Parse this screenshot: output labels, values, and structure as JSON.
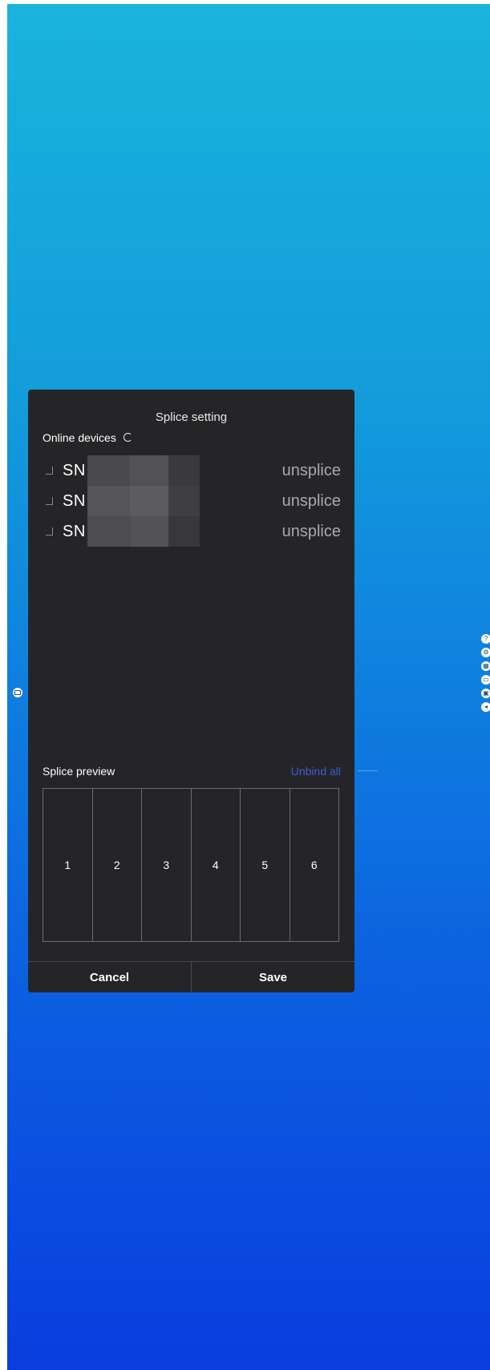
{
  "dialog": {
    "title": "Splice setting",
    "online_label": "Online devices",
    "refresh_icon": "refresh-icon",
    "devices": [
      {
        "sn_prefix": "SN",
        "status": "unsplice"
      },
      {
        "sn_prefix": "SN",
        "status": "unsplice"
      },
      {
        "sn_prefix": "SN",
        "status": "unsplice"
      }
    ],
    "preview_title": "Splice preview",
    "unbind_all": "Unbind all",
    "preview_cells": [
      "1",
      "2",
      "3",
      "4",
      "5",
      "6"
    ],
    "cancel_label": "Cancel",
    "save_label": "Save"
  },
  "side_buttons": {
    "left": "menu-icon",
    "right": [
      "help-icon",
      "settings-icon",
      "grid-icon",
      "screen-icon",
      "display-icon",
      "back-icon"
    ]
  },
  "colors": {
    "background_top": "#1ab4dc",
    "background_bottom": "#0a3ddf",
    "dialog_bg": "#252528",
    "link_color": "#3f5bd8",
    "status_text": "#a9a9ad"
  }
}
